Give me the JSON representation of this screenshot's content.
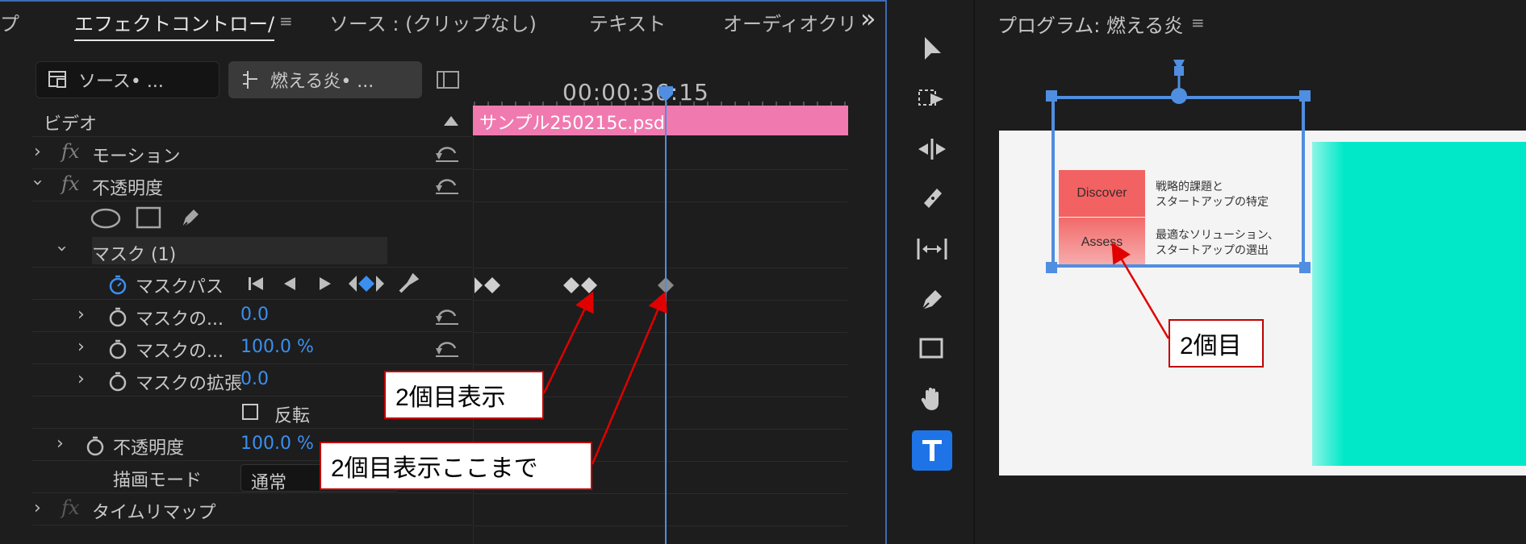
{
  "effect_controls": {
    "tabs": [
      {
        "label": "プ"
      },
      {
        "label": "エフェクトコントロー/"
      },
      {
        "label": "ソース : (クリップなし)"
      },
      {
        "label": "テキスト"
      },
      {
        "label": "オーディオクリ"
      }
    ],
    "overflow_label": "»",
    "menu_glyph": "≡",
    "source_clip": "ソース• ...",
    "sequence_clip": "燃える炎• ...",
    "video_header": "ビデオ",
    "rows": {
      "motion": "モーション",
      "opacity": "不透明度",
      "mask": "マスク (1)",
      "mask_path": "マスクパス",
      "mask_feather": {
        "label": "マスクの...",
        "value": "0.0"
      },
      "mask_opacity": {
        "label": "マスクの...",
        "value": "100.0 %"
      },
      "mask_expansion": {
        "label": "マスクの拡張",
        "value": "0.0"
      },
      "inverted": "反転",
      "opacity_prop": {
        "label": "不透明度",
        "value": "100.0 %"
      },
      "blend_mode": {
        "label": "描画モード",
        "value": "通常"
      },
      "time_remap": "タイムリマップ"
    },
    "timeline": {
      "timecode": "00:00:36:15",
      "clip_name": "サンプル250215c.psd"
    }
  },
  "program_monitor": {
    "title": "プログラム: 燃える炎",
    "slide": {
      "discover_label": "Discover",
      "discover_text": [
        "戦略的課題と",
        "スタートアップの特定"
      ],
      "assess_label": "Assess",
      "assess_text": [
        "最適なソリューション、",
        "スタートアップの選出"
      ]
    }
  },
  "annotations": {
    "note1": "2個目表示",
    "note2": "2個目表示ここまで",
    "note3": "2個目"
  },
  "colors": {
    "accent": "#4f8ee0",
    "value_blue": "#3b8ff0",
    "clip_pink": "#f07ab0",
    "teal": "#00e8c8",
    "annotation_red": "#c00000"
  },
  "tools": [
    "selection-tool",
    "track-select-tool",
    "ripple-edit-tool",
    "razor-tool",
    "slip-tool",
    "pen-tool",
    "rectangle-tool",
    "hand-tool",
    "type-tool"
  ]
}
